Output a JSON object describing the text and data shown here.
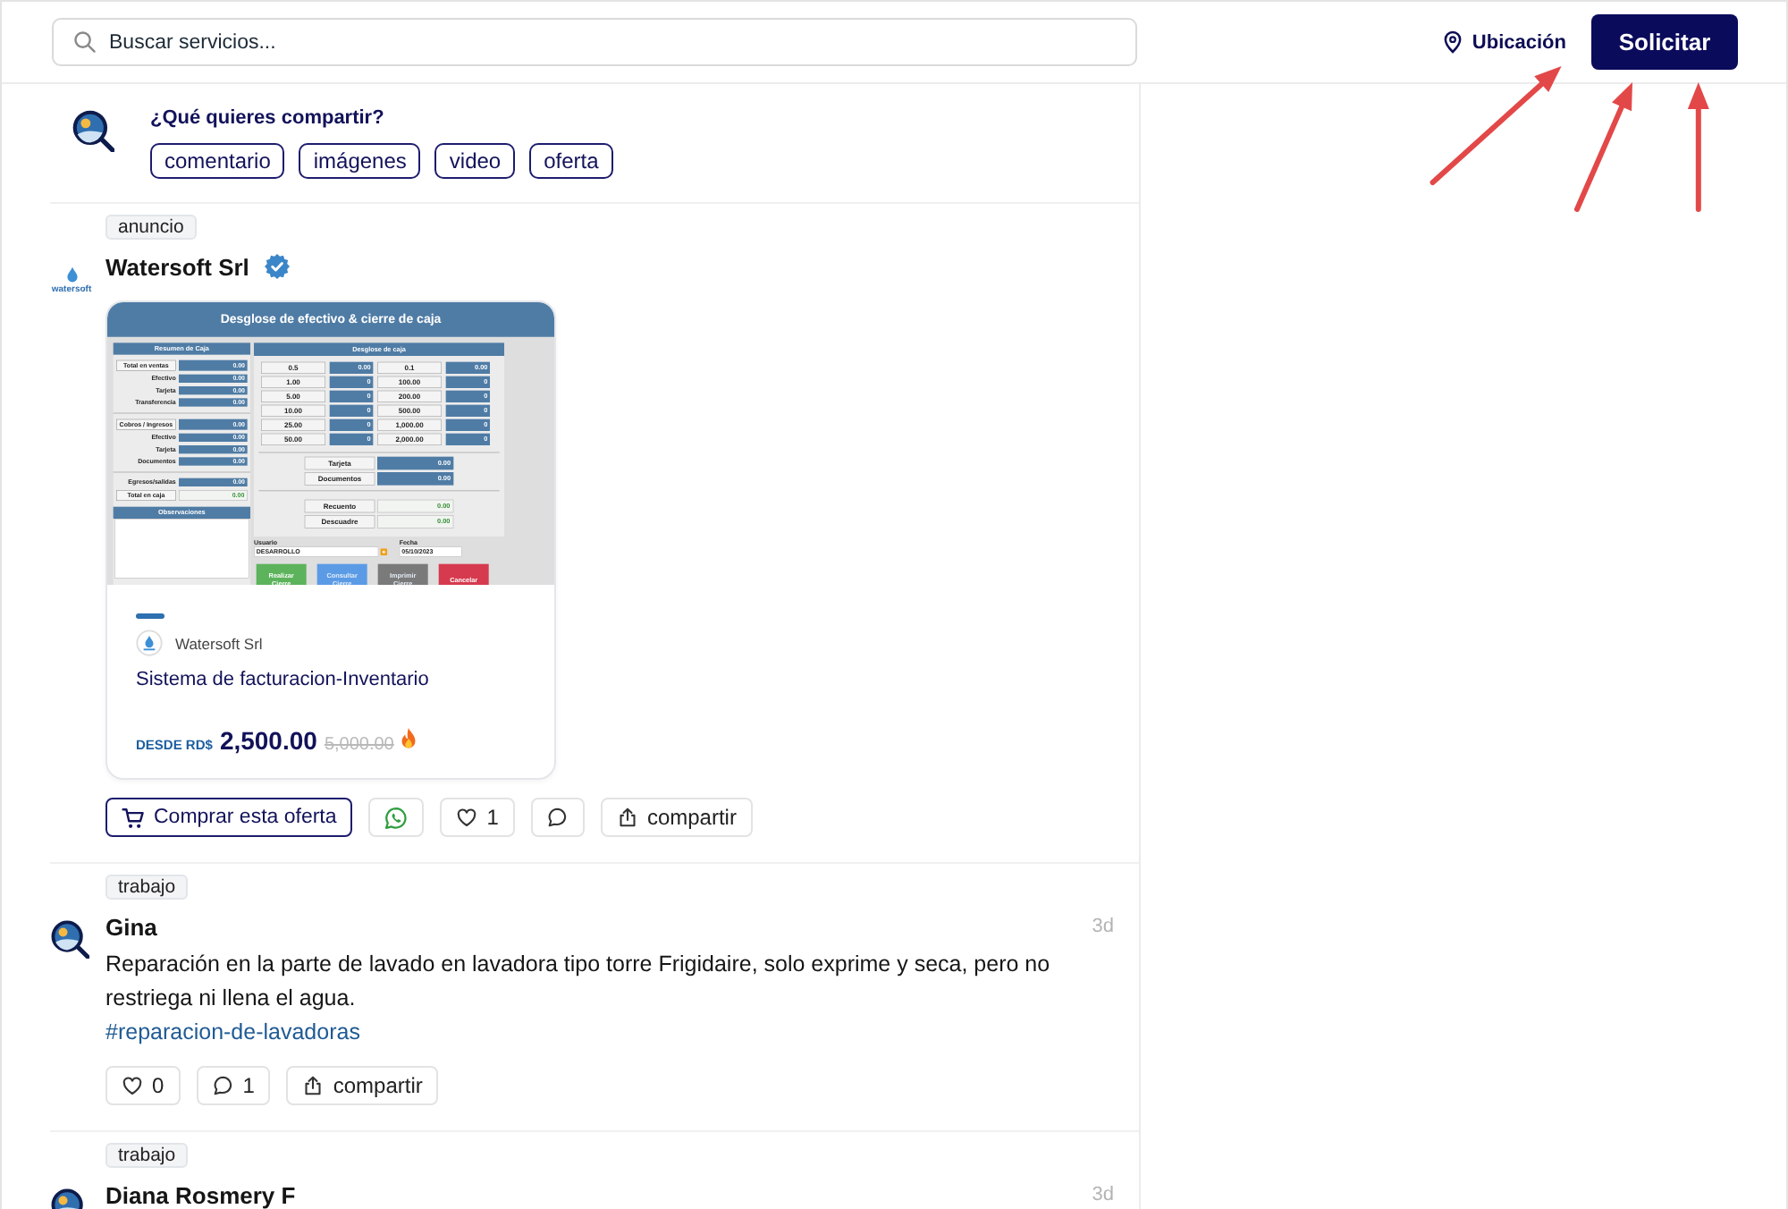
{
  "header": {
    "search": {
      "placeholder": "Buscar servicios..."
    },
    "location": {
      "label": "Ubicación"
    },
    "request_button": {
      "label": "Solicitar"
    }
  },
  "annotations": [
    {
      "kind": "arrow"
    },
    {
      "kind": "arrow"
    },
    {
      "kind": "arrow"
    }
  ],
  "composer": {
    "prompt": "¿Qué quieres compartir?",
    "options": [
      {
        "label": "comentario"
      },
      {
        "label": "imágenes"
      },
      {
        "label": "video"
      },
      {
        "label": "oferta"
      }
    ]
  },
  "posts": [
    {
      "kind": "offer",
      "tag": "anuncio",
      "author": "Watersoft Srl",
      "verified": true,
      "logo_text": "watersoft",
      "offer": {
        "image": {
          "title": "Desglose de efectivo & cierre de caja",
          "summary": {
            "header": "Resumen de Caja",
            "groups": [
              [
                {
                  "kind": "total",
                  "label": "Total en ventas",
                  "value": "0.00"
                },
                {
                  "kind": "detail",
                  "label": "Efectivo",
                  "value": "0.00"
                },
                {
                  "kind": "detail",
                  "label": "Tarjeta",
                  "value": "0.00"
                },
                {
                  "kind": "detail",
                  "label": "Transferencia",
                  "value": "0.00"
                }
              ],
              [
                {
                  "kind": "total",
                  "label": "Cobros / Ingresos",
                  "value": "0.00"
                },
                {
                  "kind": "detail",
                  "label": "Efectivo",
                  "value": "0.00"
                },
                {
                  "kind": "detail",
                  "label": "Tarjeta",
                  "value": "0.00"
                },
                {
                  "kind": "detail",
                  "label": "Documentos",
                  "value": "0.00"
                }
              ],
              [
                {
                  "kind": "detail",
                  "label": "Egresos/salidas",
                  "value": "0.00"
                },
                {
                  "kind": "result",
                  "label": "Total en caja",
                  "value": "0.00"
                }
              ]
            ],
            "notes_header": "Observaciones"
          },
          "breakdown": {
            "header": "Desglose de caja",
            "denominations": [
              {
                "label": "0.5",
                "value": "0.00"
              },
              {
                "label": "0.1",
                "value": "0.00"
              },
              {
                "label": "1.00",
                "value": "0"
              },
              {
                "label": "100.00",
                "value": "0"
              },
              {
                "label": "5.00",
                "value": "0"
              },
              {
                "label": "200.00",
                "value": "0"
              },
              {
                "label": "10.00",
                "value": "0"
              },
              {
                "label": "500.00",
                "value": "0"
              },
              {
                "label": "25.00",
                "value": "0"
              },
              {
                "label": "1,000.00",
                "value": "0"
              },
              {
                "label": "50.00",
                "value": "0"
              },
              {
                "label": "2,000.00",
                "value": "0"
              }
            ],
            "card_rows": [
              {
                "kind": "total",
                "label": "Tarjeta",
                "value": "0.00"
              },
              {
                "kind": "total",
                "label": "Documentos",
                "value": "0.00"
              }
            ],
            "count_rows": [
              {
                "kind": "result",
                "label": "Recuento",
                "value": "0.00"
              },
              {
                "kind": "result",
                "label": "Descuadre",
                "value": "0.00"
              }
            ]
          },
          "user": {
            "label": "Usuario",
            "value": "DESARROLLO"
          },
          "date": {
            "label": "Fecha",
            "value": "05/10/2023"
          },
          "buttons": [
            {
              "label": "Realizar Cierre",
              "color": "#5cb35c",
              "disabled": false
            },
            {
              "label": "Consultar Cierre",
              "color": "#5b9be6",
              "disabled": true
            },
            {
              "label": "Imprimir Cierre",
              "color": "#7a7a7a",
              "disabled": true
            },
            {
              "label": "Cancelar",
              "color": "#d63a4e",
              "disabled": false
            }
          ]
        },
        "seller": "Watersoft Srl",
        "title": "Sistema de facturacion-Inventario",
        "price_prefix": "DESDE RD$",
        "price": "2,500.00",
        "old_price": "5,000.00"
      },
      "actions": [
        {
          "kind": "buy",
          "label": "Comprar esta oferta"
        },
        {
          "kind": "whatsapp"
        },
        {
          "kind": "like",
          "count": "1"
        },
        {
          "kind": "comment"
        },
        {
          "kind": "share",
          "label": "compartir"
        }
      ]
    },
    {
      "kind": "text",
      "tag": "trabajo",
      "author": "Gina",
      "verified": false,
      "time": "3d",
      "text": "Reparación en la parte de lavado en lavadora tipo torre Frigidaire, solo exprime y seca, pero no restriega ni llena el agua.",
      "hashtag": "#reparacion-de-lavadoras",
      "actions": [
        {
          "kind": "like",
          "count": "0"
        },
        {
          "kind": "comment",
          "count": "1"
        },
        {
          "kind": "share",
          "label": "compartir"
        }
      ]
    },
    {
      "kind": "text",
      "tag": "trabajo",
      "author": "Diana Rosmery F",
      "verified": false,
      "time": "3d"
    }
  ]
}
